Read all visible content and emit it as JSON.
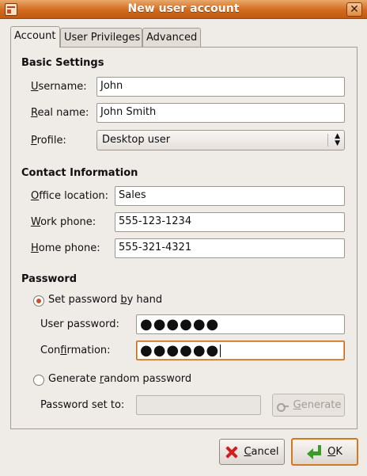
{
  "window": {
    "title": "New user account"
  },
  "tabs": [
    {
      "label": "Account",
      "active": true
    },
    {
      "label": "User Privileges",
      "active": false
    },
    {
      "label": "Advanced",
      "active": false
    }
  ],
  "basic_settings": {
    "title": "Basic Settings",
    "username": {
      "label_pre": "",
      "label_u": "U",
      "label_post": "sername:",
      "value": "John"
    },
    "real_name": {
      "label_pre": "",
      "label_u": "R",
      "label_post": "eal name:",
      "value": "John Smith"
    },
    "profile": {
      "label_pre": "",
      "label_u": "P",
      "label_post": "rofile:",
      "value": "Desktop user"
    }
  },
  "contact": {
    "title": "Contact Information",
    "office": {
      "label_pre": "",
      "label_u": "O",
      "label_post": "ffice location:",
      "value": "Sales"
    },
    "work_phone": {
      "label_pre": "",
      "label_u": "W",
      "label_post": "ork phone:",
      "value": "555-123-1234"
    },
    "home_phone": {
      "label_pre": "",
      "label_u": "H",
      "label_post": "ome phone:",
      "value": "555-321-4321"
    }
  },
  "password": {
    "title": "Password",
    "set_by_hand": {
      "label_pre": "Set password ",
      "label_u": "b",
      "label_post": "y hand",
      "checked": true
    },
    "user_password": {
      "label": "User password:",
      "value": "●●●●●●"
    },
    "confirmation": {
      "label_pre": "Con",
      "label_u": "f",
      "label_post": "irmation:",
      "value": "●●●●●●"
    },
    "generate_random": {
      "label_pre": "Generate ",
      "label_u": "r",
      "label_post": "andom password",
      "checked": false
    },
    "password_set_to": {
      "label": "Password set to:",
      "value": ""
    },
    "generate_button": {
      "label_pre": "",
      "label_u": "G",
      "label_post": "enerate"
    }
  },
  "buttons": {
    "cancel": {
      "label_pre": "",
      "label_u": "C",
      "label_post": "ancel"
    },
    "ok": {
      "label_pre": "",
      "label_u": "O",
      "label_post": "K"
    }
  }
}
